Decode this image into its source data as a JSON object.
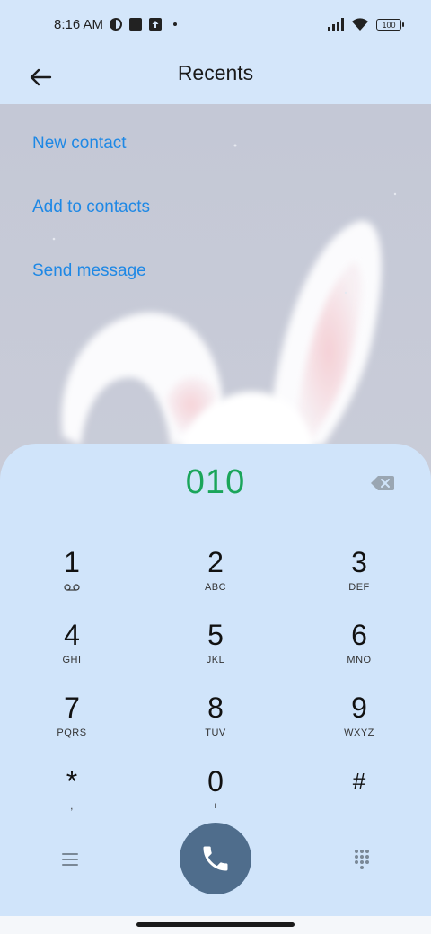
{
  "status": {
    "time": "8:16 AM",
    "battery": "100",
    "icons": [
      "vpn-icon",
      "square-notification-icon",
      "upload-icon",
      "signal-icon",
      "wifi-icon"
    ]
  },
  "header": {
    "title": "Recents",
    "back_icon": "arrow-left-icon"
  },
  "actions": {
    "new_contact": "New contact",
    "add_to_contacts": "Add to contacts",
    "send_message": "Send message"
  },
  "dialer": {
    "number": "010",
    "number_color": "#1aa55a",
    "keys": [
      {
        "digit": "1",
        "letters": ""
      },
      {
        "digit": "2",
        "letters": "ABC"
      },
      {
        "digit": "3",
        "letters": "DEF"
      },
      {
        "digit": "4",
        "letters": "GHI"
      },
      {
        "digit": "5",
        "letters": "JKL"
      },
      {
        "digit": "6",
        "letters": "MNO"
      },
      {
        "digit": "7",
        "letters": "PQRS"
      },
      {
        "digit": "8",
        "letters": "TUV"
      },
      {
        "digit": "9",
        "letters": "WXYZ"
      },
      {
        "digit": "*",
        "letters": ","
      },
      {
        "digit": "0",
        "letters": "+"
      },
      {
        "digit": "#",
        "letters": ""
      }
    ],
    "call_color": "#4f6d8c"
  }
}
